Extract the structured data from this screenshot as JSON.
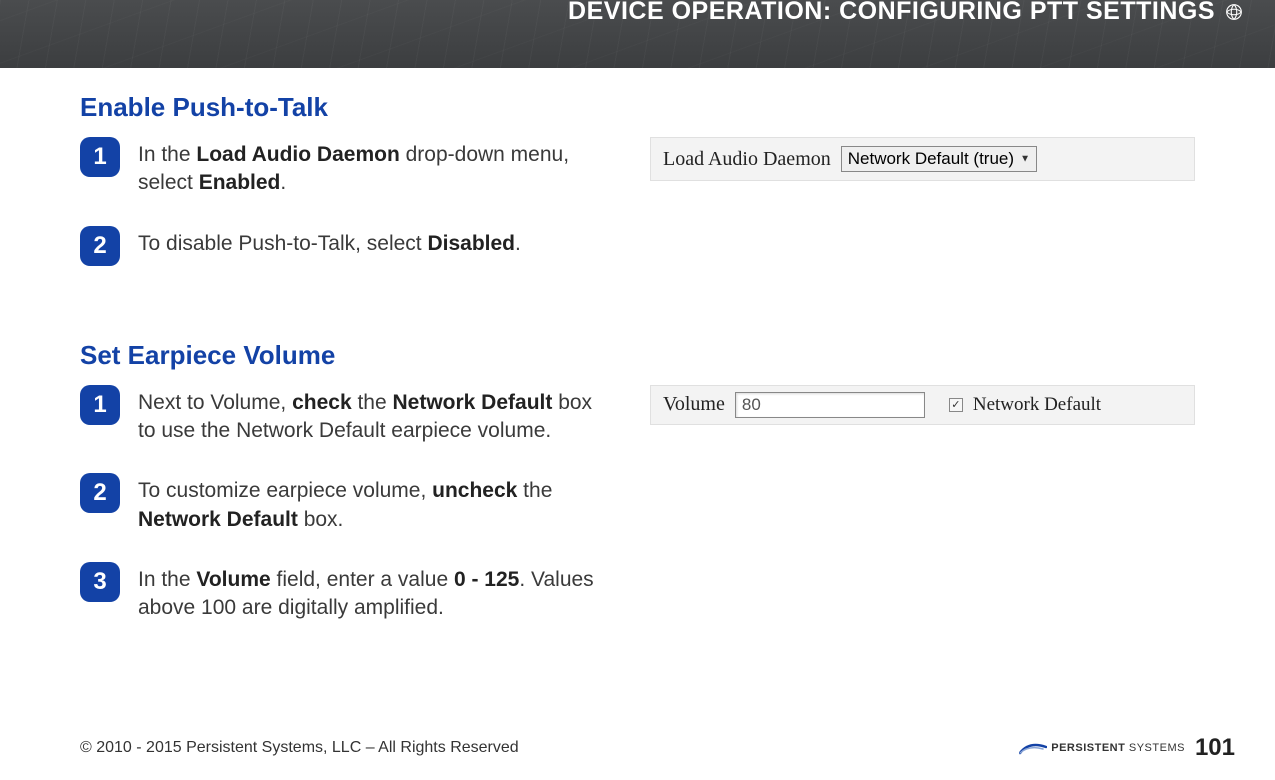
{
  "header": {
    "title": "DEVICE OPERATION:  CONFIGURING PTT SETTINGS"
  },
  "section1": {
    "title": "Enable Push-to-Talk",
    "step1": {
      "num": "1",
      "t1": "In the ",
      "b1": "Load Audio Daemon",
      "t2": " drop-down menu, select ",
      "b2": "Enabled",
      "t3": "."
    },
    "step2": {
      "num": "2",
      "t1": "To disable Push-to-Talk, select ",
      "b1": "Disabled",
      "t2": "."
    },
    "snippet": {
      "label": "Load Audio Daemon",
      "select_value": "Network Default (true)"
    }
  },
  "section2": {
    "title": "Set Earpiece Volume",
    "step1": {
      "num": "1",
      "t1": "Next to Volume, ",
      "b1": "check",
      "t2": " the ",
      "b2": "Network De­fault",
      "t3": " box to use the Network Default ear­piece volume."
    },
    "step2": {
      "num": "2",
      "t1": "To customize earpiece volume, ",
      "b1": "uncheck",
      "t2": " the ",
      "b2": "Network Default",
      "t3": " box."
    },
    "step3": {
      "num": "3",
      "t1": "In the ",
      "b1": "Volume",
      "t2": " field, enter a value ",
      "b2": "0 - 125",
      "t3": ". Values above 100 are digitally amplified."
    },
    "snippet": {
      "label": "Volume",
      "input_value": "80",
      "checkbox_checked": "✓",
      "checkbox_label": "Network Default"
    }
  },
  "footer": {
    "copyright": "© 2010 - 2015 Persistent Systems, LLC – All Rights Reserved",
    "logo_bold": "PERSISTENT",
    "logo_rest": " SYSTEMS",
    "page": "101"
  }
}
